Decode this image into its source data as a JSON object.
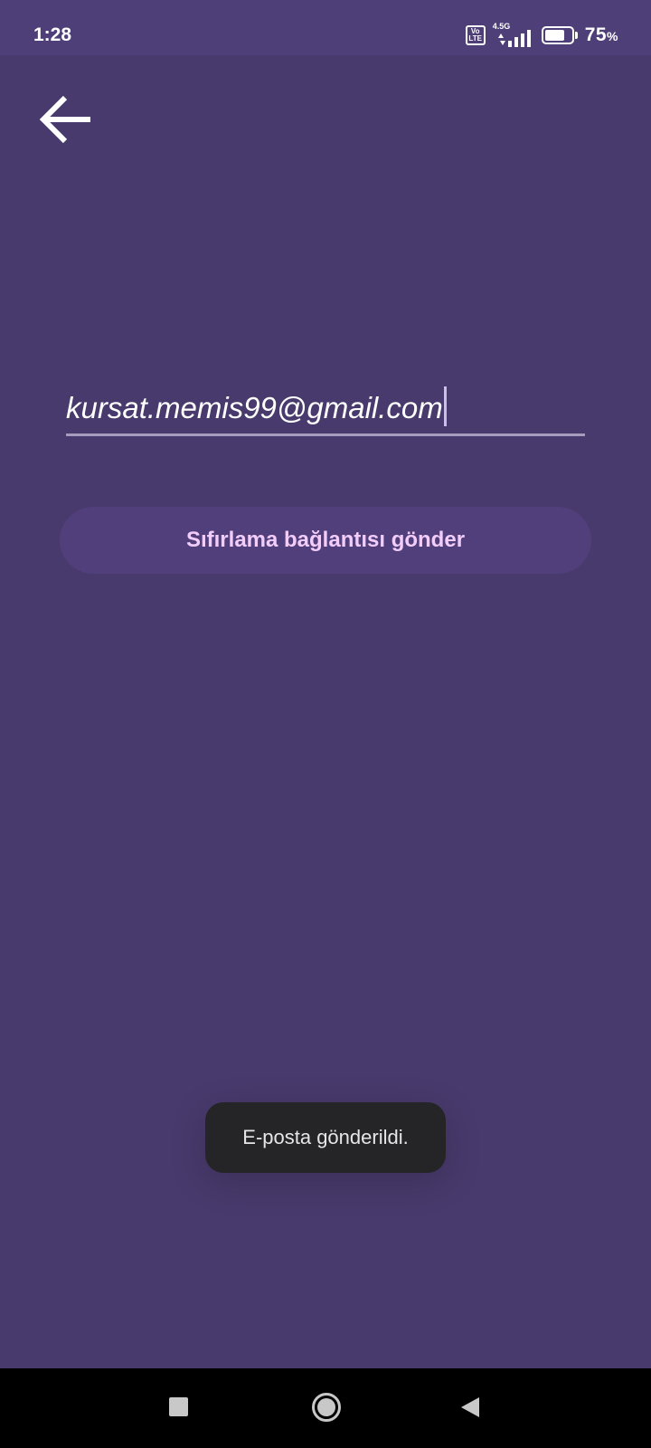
{
  "status_bar": {
    "time": "1:28",
    "volte_line1": "Vo",
    "volte_line2": "LTE",
    "network_type": "4.5G",
    "battery_percent": "75",
    "battery_unit": "%",
    "battery_level": 0.75,
    "icons": [
      "volte-icon",
      "signal-icon",
      "battery-icon"
    ]
  },
  "header": {
    "back_icon": "arrow-left-icon"
  },
  "form": {
    "email_value": "kursat.memis99@gmail.com",
    "submit_label": "Sıfırlama bağlantısı gönder"
  },
  "toast": {
    "message": "E-posta gönderildi."
  },
  "nav_bar": {
    "icons": [
      "recents-icon",
      "home-icon",
      "back-triangle-icon"
    ]
  },
  "colors": {
    "background": "#483a6c",
    "status_bar": "#4e3f78",
    "button_bg": "#503f7a",
    "button_text": "#f2cdfa",
    "toast_bg": "#252527"
  }
}
